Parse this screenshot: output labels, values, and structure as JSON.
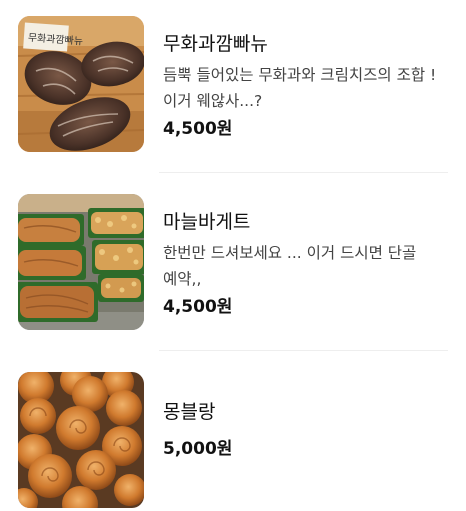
{
  "products": [
    {
      "name": "무화과깜빠뉴",
      "description": "듬뿍 들어있는 무화과와 크림치즈의 조합 ! 이거 웨않사...?",
      "price": "4,500원",
      "image_icon": "fig-campagne-bread-photo",
      "image_label": "무화과깜빠뉴"
    },
    {
      "name": "마늘바게트",
      "description": "한번만 드셔보세요 ... 이거 드시면 단골 예약,,",
      "price": "4,500원",
      "image_icon": "garlic-baguette-photo"
    },
    {
      "name": "몽블랑",
      "description": "",
      "price": "5,000원",
      "image_icon": "mont-blanc-pastry-photo"
    }
  ]
}
